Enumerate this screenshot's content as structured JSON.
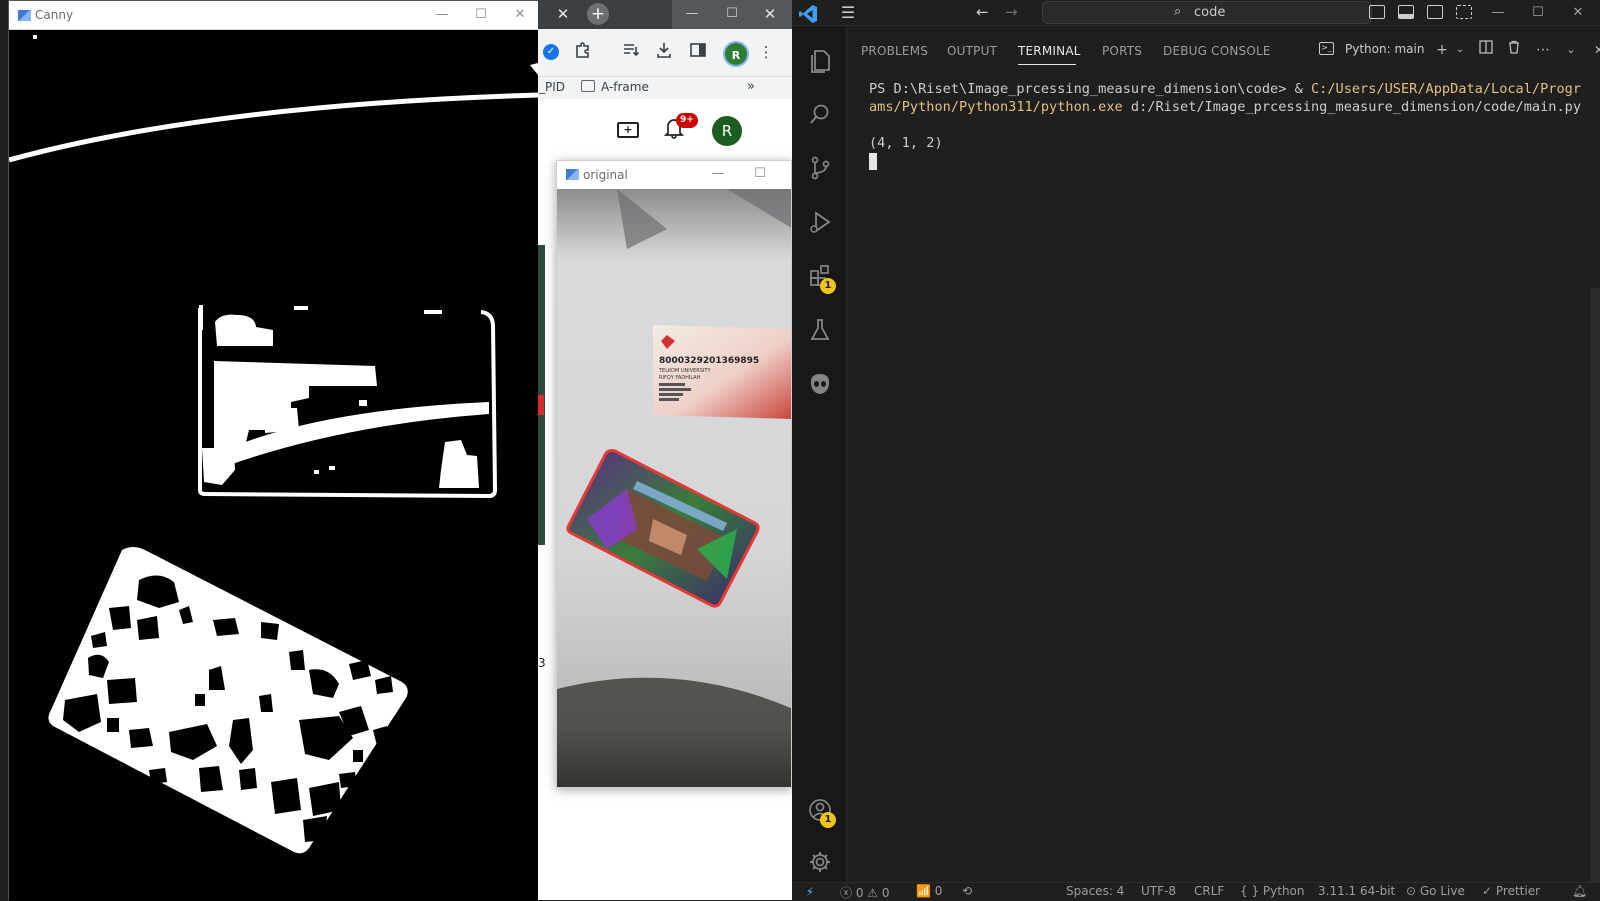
{
  "browser": {
    "tab_close": "✕",
    "new_tab": "+",
    "win_min": "—",
    "win_max": "☐",
    "win_close": "✕",
    "bookmark_pid": "_PID",
    "bookmark_aframe": "A-frame",
    "bookmark_more": "»",
    "avatar_letter": "R",
    "user_letter": "R",
    "notification_badge": "9+",
    "side_digit": "3"
  },
  "canny_window": {
    "title": "Canny",
    "min": "—",
    "max": "☐",
    "close": "✕"
  },
  "original_window": {
    "title": "original",
    "min": "—",
    "max": "☐",
    "card_number": "8000329201369895",
    "card_line1": "TELKOM UNIVERSITY",
    "card_line2": "RIFQY FADHILAH"
  },
  "vscode": {
    "search": "code",
    "activity_badges": {
      "extensions": "1",
      "accounts": "1"
    },
    "panel_tabs": [
      {
        "label": "PROBLEMS",
        "active": false
      },
      {
        "label": "OUTPUT",
        "active": false
      },
      {
        "label": "TERMINAL",
        "active": true
      },
      {
        "label": "PORTS",
        "active": false
      },
      {
        "label": "DEBUG CONSOLE",
        "active": false
      }
    ],
    "terminal_profile": "Python: main",
    "terminal": {
      "prompt": "PS D:\\Riset\\Image_prcessing_measure_dimension\\code> & ",
      "exe_path": "C:/Users/USER/AppData/Local/Programs/Python/Python311/python.exe",
      "script_path": " d:/Riset/Image_prcessing_measure_dimension/code/main.py",
      "output": "(4, 1, 2)"
    },
    "status": {
      "errors": "0",
      "warnings": "0",
      "ports": "0",
      "spaces": "Spaces: 4",
      "encoding": "UTF-8",
      "eol": "CRLF",
      "language": "Python",
      "interpreter": "3.11.1 64-bit",
      "go_live": "Go Live",
      "prettier": "Prettier"
    }
  },
  "colors": {
    "accent_yellow": "#e5c07b",
    "vscode_blue": "#3e9ff5",
    "badge_yellow": "#f0c419",
    "badge_red": "#cc0000"
  }
}
